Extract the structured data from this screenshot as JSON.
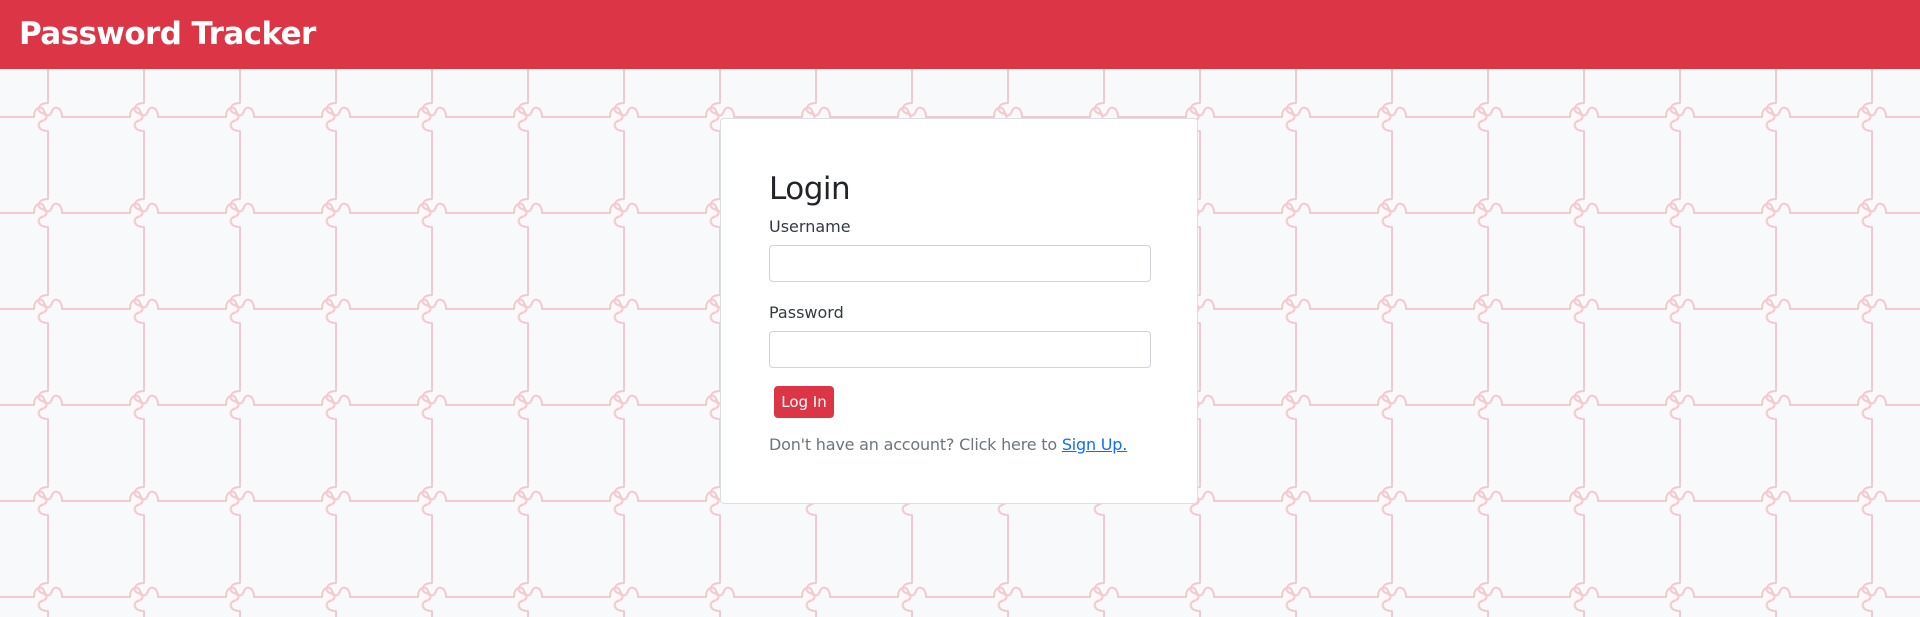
{
  "app": {
    "title": "Password Tracker"
  },
  "login": {
    "title": "Login",
    "username_label": "Username",
    "username_value": "",
    "password_label": "Password",
    "password_value": "",
    "submit_label": "Log In",
    "signup_prompt": "Don't have an account? Click here to ",
    "signup_link": "Sign Up."
  },
  "colors": {
    "brand": "#dc3545",
    "background": "#f8f9fa",
    "pattern": "#f4c9cd",
    "link": "#0d6efd"
  },
  "icons": {
    "background_pattern": "puzzle-pattern"
  }
}
